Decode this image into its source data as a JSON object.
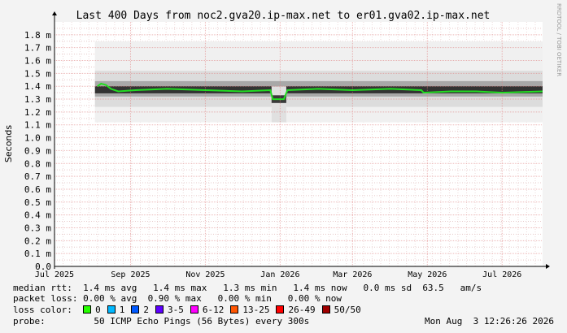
{
  "title": "Last 400 Days from noc2.gva20.ip-max.net to er01.gva02.ip-max.net",
  "side_label": "RRDTOOL / TOBI OETIKER",
  "ylabel": "Seconds",
  "chart_data": {
    "type": "area",
    "title": "Last 400 Days from noc2.gva20.ip-max.net to er01.gva02.ip-max.net",
    "ylabel": "Seconds",
    "ylim": [
      0,
      1.9
    ],
    "y_ticks": [
      {
        "v": 0.0,
        "label": "0.0"
      },
      {
        "v": 0.1,
        "label": "0.1 m"
      },
      {
        "v": 0.2,
        "label": "0.2 m"
      },
      {
        "v": 0.3,
        "label": "0.3 m"
      },
      {
        "v": 0.4,
        "label": "0.4 m"
      },
      {
        "v": 0.5,
        "label": "0.5 m"
      },
      {
        "v": 0.6,
        "label": "0.6 m"
      },
      {
        "v": 0.7,
        "label": "0.7 m"
      },
      {
        "v": 0.8,
        "label": "0.8 m"
      },
      {
        "v": 0.9,
        "label": "0.9 m"
      },
      {
        "v": 1.0,
        "label": "1.0 m"
      },
      {
        "v": 1.1,
        "label": "1.1 m"
      },
      {
        "v": 1.2,
        "label": "1.2 m"
      },
      {
        "v": 1.3,
        "label": "1.3 m"
      },
      {
        "v": 1.4,
        "label": "1.4 m"
      },
      {
        "v": 1.5,
        "label": "1.5 m"
      },
      {
        "v": 1.6,
        "label": "1.6 m"
      },
      {
        "v": 1.7,
        "label": "1.7 m"
      },
      {
        "v": 1.8,
        "label": "1.8 m"
      }
    ],
    "xlim": [
      "2025-07-01",
      "2026-08-03"
    ],
    "x_ticks": [
      {
        "date": "2025-07-01",
        "label": "Jul 2025"
      },
      {
        "date": "2025-09-01",
        "label": "Sep 2025"
      },
      {
        "date": "2025-11-01",
        "label": "Nov 2025"
      },
      {
        "date": "2026-01-01",
        "label": "Jan 2026"
      },
      {
        "date": "2026-03-01",
        "label": "Mar 2026"
      },
      {
        "date": "2026-05-01",
        "label": "May 2026"
      },
      {
        "date": "2026-07-01",
        "label": "Jul 2026"
      }
    ],
    "grid": true,
    "series": [
      {
        "name": "median rtt",
        "color": "#22dd22",
        "points": [
          {
            "x": "2025-08-05",
            "y": 1.4
          },
          {
            "x": "2025-08-08",
            "y": 1.42
          },
          {
            "x": "2025-08-12",
            "y": 1.41
          },
          {
            "x": "2025-08-16",
            "y": 1.38
          },
          {
            "x": "2025-08-22",
            "y": 1.36
          },
          {
            "x": "2025-09-05",
            "y": 1.37
          },
          {
            "x": "2025-10-01",
            "y": 1.38
          },
          {
            "x": "2025-11-01",
            "y": 1.37
          },
          {
            "x": "2025-12-01",
            "y": 1.36
          },
          {
            "x": "2025-12-24",
            "y": 1.37
          },
          {
            "x": "2025-12-26",
            "y": 1.3
          },
          {
            "x": "2026-01-04",
            "y": 1.3
          },
          {
            "x": "2026-01-07",
            "y": 1.37
          },
          {
            "x": "2026-02-01",
            "y": 1.38
          },
          {
            "x": "2026-03-01",
            "y": 1.37
          },
          {
            "x": "2026-04-01",
            "y": 1.38
          },
          {
            "x": "2026-04-26",
            "y": 1.37
          },
          {
            "x": "2026-04-28",
            "y": 1.35
          },
          {
            "x": "2026-05-20",
            "y": 1.36
          },
          {
            "x": "2026-06-10",
            "y": 1.36
          },
          {
            "x": "2026-07-01",
            "y": 1.35
          },
          {
            "x": "2026-08-03",
            "y": 1.36
          }
        ]
      }
    ],
    "smoke_band": {
      "start": "2025-08-03",
      "end": "2026-08-03",
      "min_y": 1.12,
      "max_y": 1.75
    }
  },
  "stats": {
    "median_rtt": "median rtt:  1.4 ms avg   1.4 ms max   1.3 ms min   1.4 ms now   0.0 ms sd  63.5   am/s",
    "packet_loss": "packet loss: 0.00 % avg  0.90 % max   0.00 % min   0.00 % now"
  },
  "loss_color": {
    "label": "loss color:",
    "items": [
      {
        "label": "0",
        "color": "#26ff00"
      },
      {
        "label": "1",
        "color": "#00b8ff"
      },
      {
        "label": "2",
        "color": "#0059ff"
      },
      {
        "label": "3-5",
        "color": "#5e00ff"
      },
      {
        "label": "6-12",
        "color": "#ff00ff"
      },
      {
        "label": "13-25",
        "color": "#ff5500"
      },
      {
        "label": "26-49",
        "color": "#ff0000"
      },
      {
        "label": "50/50",
        "color": "#a00000"
      }
    ]
  },
  "probe": {
    "label": "probe:",
    "text": "50 ICMP Echo Pings (56 Bytes) every 300s",
    "timestamp": "Mon Aug  3 12:26:26 2026"
  }
}
